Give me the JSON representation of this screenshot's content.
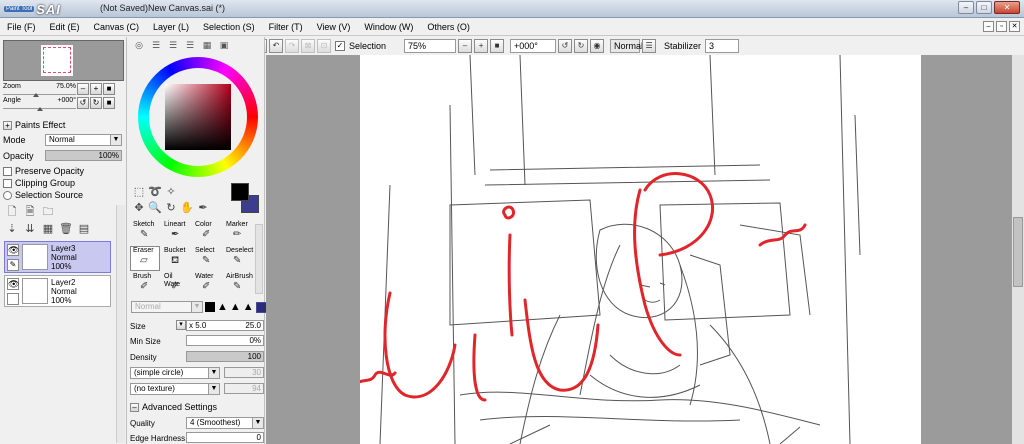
{
  "app": {
    "logo_small": "Paint Tool",
    "logo_big": "SAI",
    "title": "(Not Saved)New Canvas.sai (*)"
  },
  "menu": [
    "File (F)",
    "Edit (E)",
    "Canvas (C)",
    "Layer (L)",
    "Selection (S)",
    "Filter (T)",
    "View (V)",
    "Window (W)",
    "Others (O)"
  ],
  "toolbar": {
    "selection_label": "Selection",
    "zoom": "75%",
    "angle": "+000°",
    "blend": "Normal",
    "stabilizer_label": "Stabilizer",
    "stabilizer": "3"
  },
  "navigator": {
    "zoom_label": "Zoom",
    "zoom_value": "75.0%",
    "angle_label": "Angle",
    "angle_value": "+000°"
  },
  "layer_panel": {
    "paints_effect": "Paints Effect",
    "mode_label": "Mode",
    "mode_value": "Normal",
    "opacity_label": "Opacity",
    "opacity_value": "100%",
    "preserve_opacity": "Preserve Opacity",
    "clipping_group": "Clipping Group",
    "selection_source": "Selection Source",
    "layers": [
      {
        "name": "Layer3",
        "mode": "Normal",
        "opacity": "100%"
      },
      {
        "name": "Layer2",
        "mode": "Normal",
        "opacity": "100%"
      }
    ]
  },
  "tools": [
    "Sketch",
    "Lineart",
    "Color",
    "Marker",
    "Eraser",
    "Bucket",
    "Select",
    "Deselect",
    "Brush",
    "Oil Wate",
    "Water",
    "AirBrush"
  ],
  "brush": {
    "blend": "Normal",
    "size_label": "Size",
    "size_mult": "x 5.0",
    "size_value": "25.0",
    "min_size_label": "Min Size",
    "min_size_value": "0%",
    "density_label": "Density",
    "density_value": "100",
    "shape": "(simple circle)",
    "shape_value": "30",
    "texture": "(no texture)",
    "texture_value": "94",
    "advanced": "Advanced Settings",
    "quality_label": "Quality",
    "quality_value": "4 (Smoothest)",
    "edge_label": "Edge Hardness",
    "edge_value": "0"
  },
  "colors": {
    "foreground": "#000000",
    "background": "#3c3d8e",
    "sketch_red": "#e0262b"
  }
}
